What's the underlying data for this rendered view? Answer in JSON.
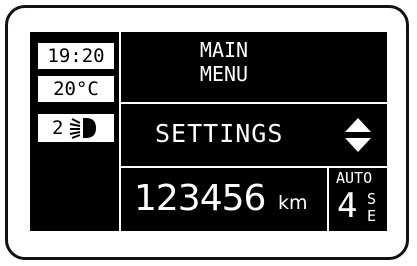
{
  "left_column": {
    "time": "19:20",
    "temperature": "20°C",
    "headlight_level": "2"
  },
  "menu": {
    "line1": "MAIN",
    "line2": "MENU",
    "item": "SETTINGS"
  },
  "odometer": {
    "value": "123456",
    "unit": "km"
  },
  "gearbox": {
    "mode": "AUTO",
    "gear": "4",
    "sport_letter": "S",
    "eco_letter": "E"
  },
  "icons": {
    "headlight": "headlight-beam-icon",
    "updown": "up-down-arrows-icon"
  },
  "colors": {
    "display_bg": "#000000",
    "display_fg": "#ffffff"
  }
}
